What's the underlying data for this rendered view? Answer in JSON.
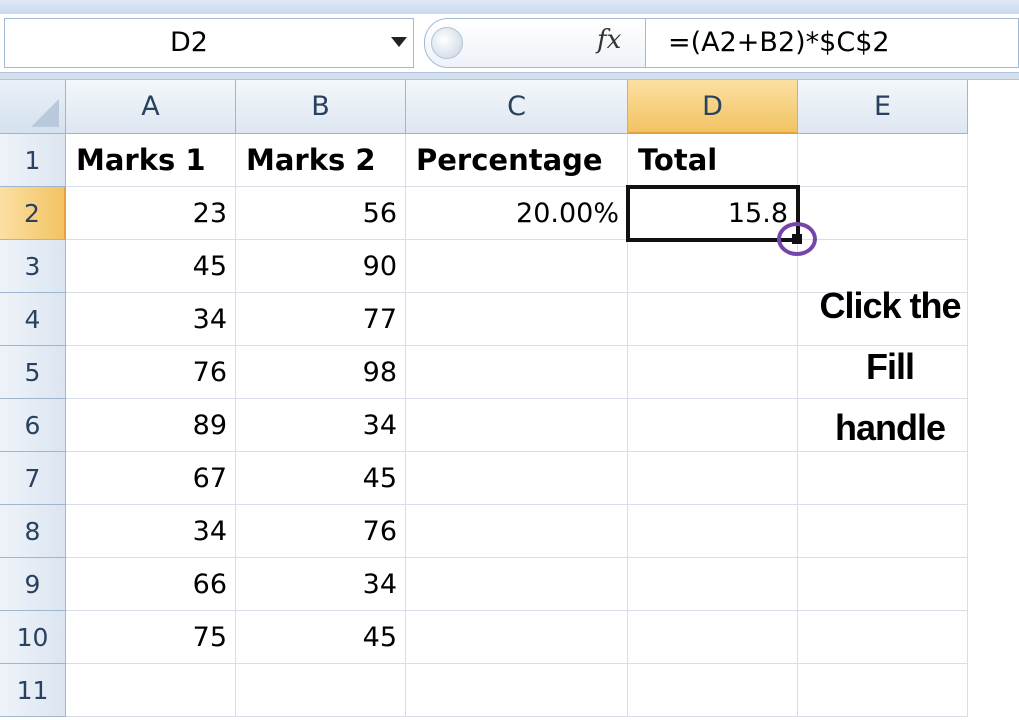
{
  "name_box": {
    "value": "D2"
  },
  "formula_bar": {
    "fx_label": "fx",
    "formula": "=(A2+B2)*$C$2"
  },
  "columns": [
    "A",
    "B",
    "C",
    "D",
    "E"
  ],
  "active_column": "D",
  "active_row": "2",
  "rows": [
    {
      "num": "1",
      "a": "Marks 1",
      "b": "Marks 2",
      "c": "Percentage",
      "d": "Total",
      "e": ""
    },
    {
      "num": "2",
      "a": "23",
      "b": "56",
      "c": "20.00%",
      "d": "15.8",
      "e": ""
    },
    {
      "num": "3",
      "a": "45",
      "b": "90",
      "c": "",
      "d": "",
      "e": ""
    },
    {
      "num": "4",
      "a": "34",
      "b": "77",
      "c": "",
      "d": "",
      "e": ""
    },
    {
      "num": "5",
      "a": "76",
      "b": "98",
      "c": "",
      "d": "",
      "e": ""
    },
    {
      "num": "6",
      "a": "89",
      "b": "34",
      "c": "",
      "d": "",
      "e": ""
    },
    {
      "num": "7",
      "a": "67",
      "b": "45",
      "c": "",
      "d": "",
      "e": ""
    },
    {
      "num": "8",
      "a": "34",
      "b": "76",
      "c": "",
      "d": "",
      "e": ""
    },
    {
      "num": "9",
      "a": "66",
      "b": "34",
      "c": "",
      "d": "",
      "e": ""
    },
    {
      "num": "10",
      "a": "75",
      "b": "45",
      "c": "",
      "d": "",
      "e": ""
    },
    {
      "num": "11",
      "a": "",
      "b": "",
      "c": "",
      "d": "",
      "e": ""
    }
  ],
  "callout": {
    "line1": "Click the",
    "line2": "Fill",
    "line3": "handle"
  },
  "colors": {
    "selection_border": "#111111",
    "active_header": "#f2c362",
    "callout_ring": "#7645a9"
  }
}
